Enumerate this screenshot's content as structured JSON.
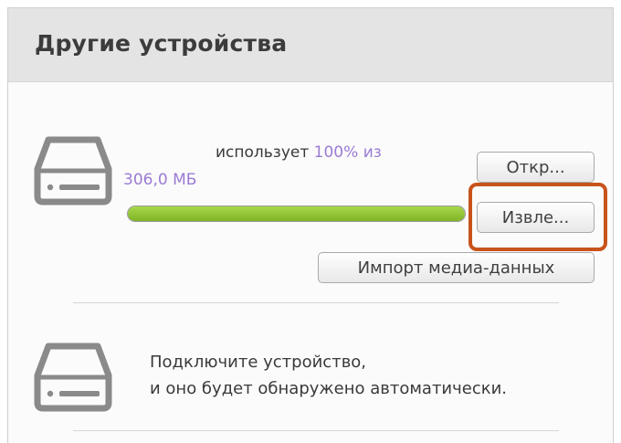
{
  "header": {
    "title": "Другие устройства"
  },
  "device": {
    "usage_prefix": "использует",
    "usage_percent": "100%",
    "usage_of": "из",
    "capacity": "306,0 МБ",
    "progress_fraction": 1.0,
    "open_label": "Откр...",
    "eject_label": "Извле...",
    "import_label": "Импорт медиа-данных"
  },
  "empty_slot": {
    "line1": "Подключите устройство,",
    "line2": "и оно будет обнаружено автоматически."
  },
  "colors": {
    "accent_text": "#9b7bd4",
    "progress_fill": "#8cc234",
    "highlight_border": "#c8531a",
    "header_bg": "#e4e4e4"
  },
  "icons": {
    "device": "drive-icon",
    "empty_slot": "drive-icon"
  }
}
